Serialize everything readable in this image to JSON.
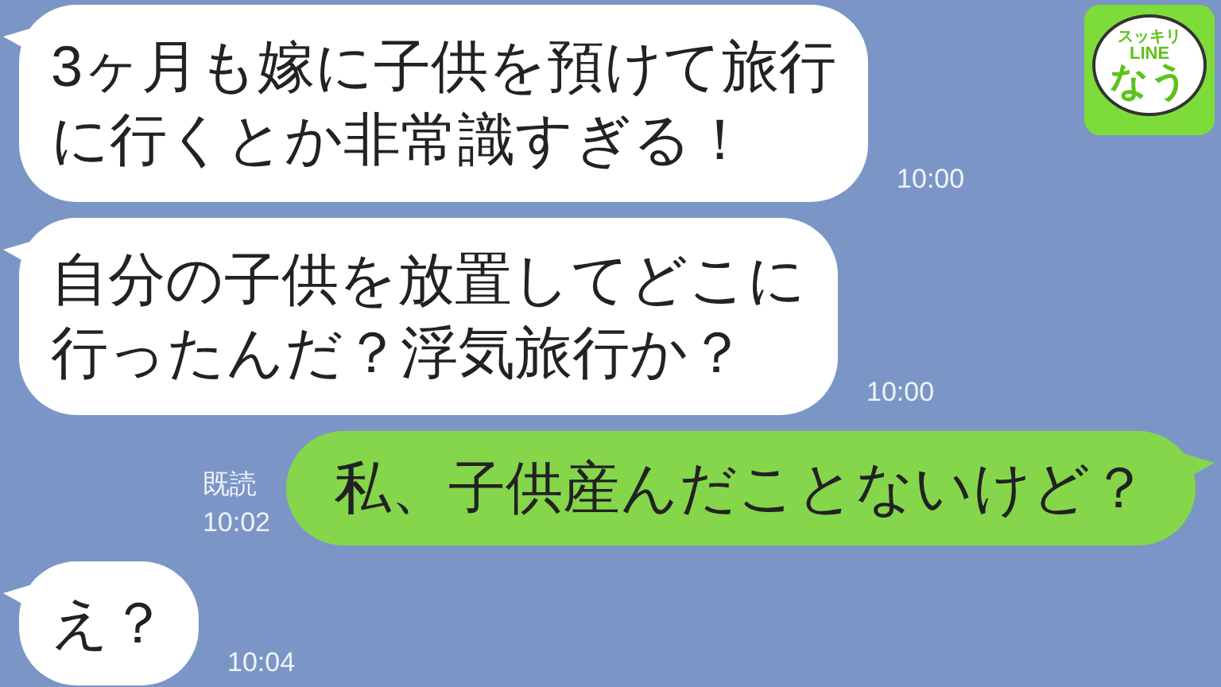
{
  "logo": {
    "top": "スッキリ",
    "middle": "LINE",
    "bottom": "なう"
  },
  "messages": [
    {
      "kind": "received",
      "lines": [
        "3ヶ月も嫁に子供を預けて旅行",
        "に行くとか非常識すぎる！"
      ],
      "time": "10:00"
    },
    {
      "kind": "received",
      "lines": [
        "自分の子供を放置してどこに",
        "行ったんだ？浮気旅行か？"
      ],
      "time": "10:00"
    },
    {
      "kind": "sent",
      "lines": [
        "私、子供産んだことないけど？"
      ],
      "read": "既読",
      "time": "10:02"
    },
    {
      "kind": "received",
      "lines": [
        "え？"
      ],
      "time": "10:04"
    }
  ]
}
